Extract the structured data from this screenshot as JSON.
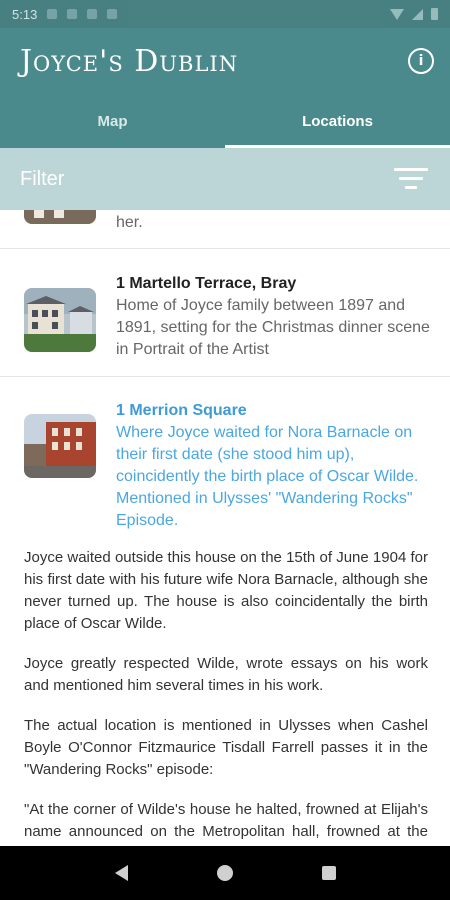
{
  "app": {
    "title": "Joyce's Dublin",
    "info_icon": "info-icon",
    "accent_color": "#4a8a8c"
  },
  "status_bar": {
    "time": "5:13"
  },
  "tabs": [
    {
      "label": "Map",
      "active": false
    },
    {
      "label": "Locations",
      "active": true
    }
  ],
  "filter": {
    "label": "Filter",
    "icon": "filter-icon"
  },
  "locations": [
    {
      "title": "",
      "description": "her.",
      "selected": false
    },
    {
      "title": "1 Martello Terrace, Bray",
      "description": "Home of Joyce family between 1897 and 1891, setting for the Christmas dinner scene in Portrait of the Artist",
      "selected": false
    },
    {
      "title": "1 Merrion Square",
      "description": "Where Joyce waited for Nora Barnacle on their first date (she stood him up), coincidently the birth place of Oscar Wilde. Mentioned in Ulysses' \"Wandering Rocks\" Episode.",
      "selected": true
    }
  ],
  "detail": {
    "paragraphs": [
      "Joyce waited outside this house on the 15th of June 1904 for his first date with his future wife Nora Barnacle, although she never turned up. The house is also coincidentally the birth place of Oscar Wilde.",
      "Joyce greatly respected Wilde, wrote essays on his work and mentioned him several times in his work.",
      "The actual location is mentioned in Ulysses when Cashel Boyle O'Connor Fitzmaurice Tisdall Farrell passes it in the \"Wandering Rocks\" episode:",
      "\"At the corner of Wilde's house he halted, frowned at Elijah's name announced on the Metropolitan hall, frowned at the distant pleasance of duke's lawn.\""
    ]
  },
  "nav": {
    "back_icon": "back-icon",
    "home_icon": "home-icon",
    "recents_icon": "recents-icon"
  }
}
